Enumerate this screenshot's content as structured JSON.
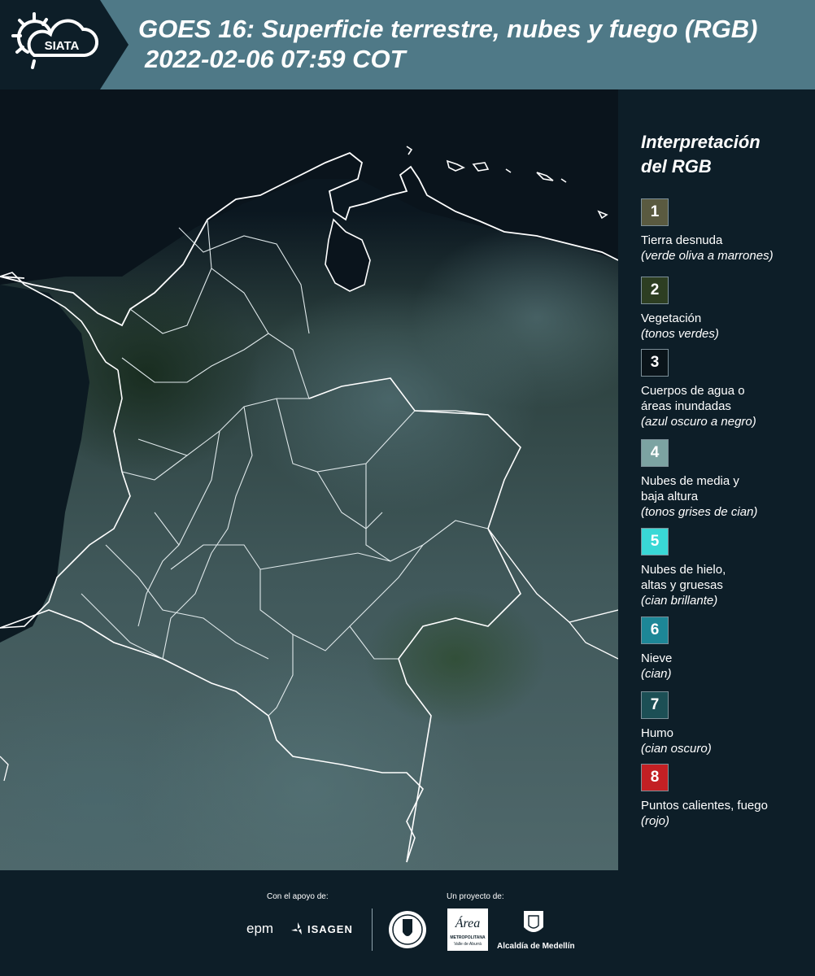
{
  "header": {
    "logo_text": "SIATA",
    "title": "GOES 16: Superficie terrestre, nubes y fuego (RGB)",
    "subtitle": "2022-02-06 07:59 COT"
  },
  "legend": {
    "title_line1": "Interpretación",
    "title_line2": "del RGB",
    "items": [
      {
        "number": "1",
        "color": "#5a5a40",
        "label_lines": [
          "Tierra desnuda"
        ],
        "description": "(verde oliva a marrones)"
      },
      {
        "number": "2",
        "color": "#2d3e22",
        "label_lines": [
          "Vegetación"
        ],
        "description": "(tonos verdes)"
      },
      {
        "number": "3",
        "color": "#0a141a",
        "label_lines": [
          "Cuerpos de agua o",
          "áreas inundadas"
        ],
        "description": "(azul oscuro a negro)"
      },
      {
        "number": "4",
        "color": "#7ca3a2",
        "label_lines": [
          "Nubes de media y",
          "baja altura"
        ],
        "description": "(tonos grises de cian)"
      },
      {
        "number": "5",
        "color": "#39d8d6",
        "label_lines": [
          "Nubes de hielo,",
          "altas y gruesas"
        ],
        "description": "(cian brillante)"
      },
      {
        "number": "6",
        "color": "#1d8797",
        "label_lines": [
          "Nieve"
        ],
        "description": "(cian)"
      },
      {
        "number": "7",
        "color": "#1c4f55",
        "label_lines": [
          "Humo"
        ],
        "description": "(cian oscuro)"
      },
      {
        "number": "8",
        "color": "#c32024",
        "label_lines": [
          "Puntos calientes, fuego"
        ],
        "description": "(rojo)"
      }
    ]
  },
  "footer": {
    "support_label": "Con el apoyo de:",
    "project_label": "Un proyecto de:",
    "sponsors": {
      "epm": "epm",
      "isagen": "ISAGEN",
      "area_metropolitana": "Área",
      "area_sub": "METROPOLITANA",
      "area_sub2": "Valle de Aburrá",
      "alcaldia": "Alcaldía de Medellín"
    }
  },
  "colors": {
    "header_bg": "#4f7987",
    "panel_bg": "#0d1e28"
  }
}
